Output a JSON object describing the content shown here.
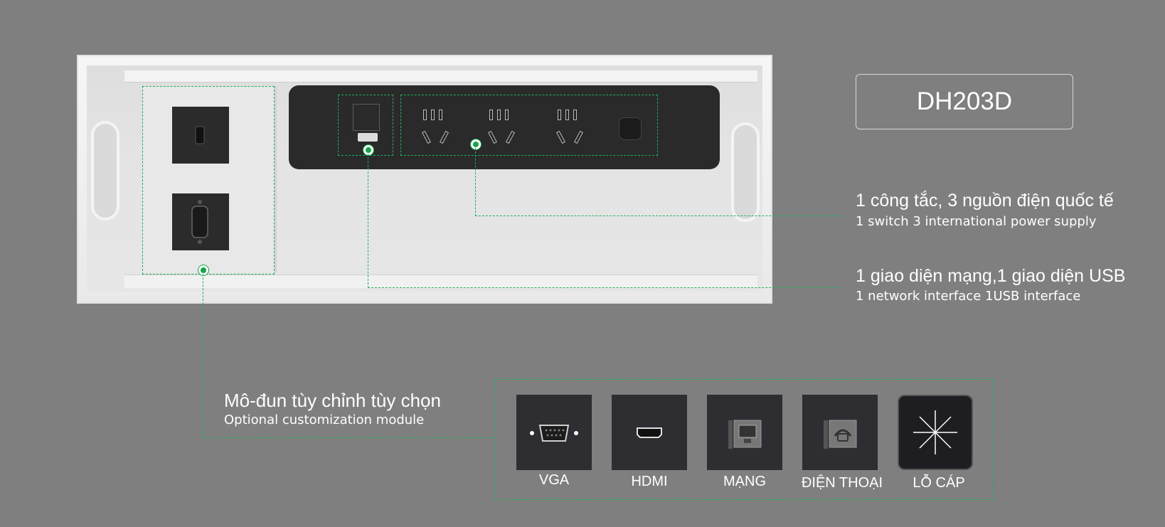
{
  "model": {
    "name": "DH203D"
  },
  "features": [
    {
      "vn": "1 công tắc, 3 nguồn điện quốc tế",
      "en": "1 switch 3 international power supply"
    },
    {
      "vn": "1 giao diện mạng,1 giao diện USB",
      "en": "1 network interface 1USB interface"
    }
  ],
  "optional": {
    "vn": "Mô-đun tùy chỉnh tùy chọn",
    "en": "Optional customization module"
  },
  "modules": [
    {
      "label": "VGA",
      "icon": "vga-port-icon"
    },
    {
      "label": "HDMI",
      "icon": "hdmi-port-icon"
    },
    {
      "label": "MẠNG",
      "icon": "network-port-icon"
    },
    {
      "label": "ĐIỆN THOẠI",
      "icon": "telephone-port-icon"
    },
    {
      "label": "LỖ CÁP",
      "icon": "cable-hole-icon"
    }
  ],
  "colors": {
    "background": "#7f7f7f",
    "callout": "#1fae5c",
    "module": "#2d2d32"
  }
}
